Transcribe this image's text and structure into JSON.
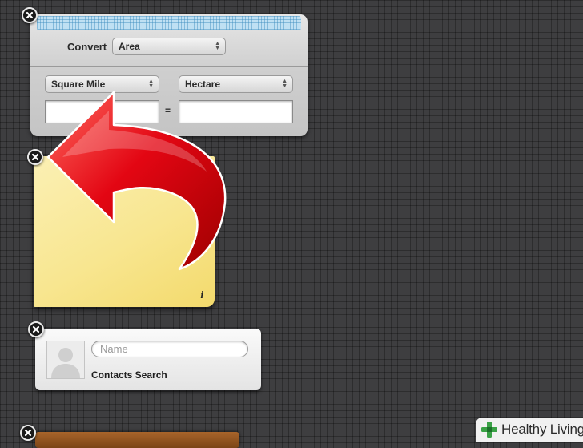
{
  "converter": {
    "convert_label": "Convert",
    "conversion_type": "Area",
    "from_unit": "Square Mile",
    "to_unit": "Hectare",
    "from_value": "",
    "to_value": "",
    "equals_sign": "="
  },
  "sticky_note": {
    "text": "",
    "info_icon": "i"
  },
  "contacts": {
    "search_placeholder": "Name",
    "title": "Contacts Search"
  },
  "watermark": {
    "brand": "Healthy Living"
  },
  "icons": {
    "close": "close-icon",
    "chevron": "up-down-chevron-icon",
    "avatar": "person-silhouette-icon",
    "arrow": "red-curved-arrow",
    "logo": "plus-icon"
  },
  "colors": {
    "sticky": "#f8e690",
    "arrow": "#e30613",
    "logo_green": "#3aa146"
  }
}
